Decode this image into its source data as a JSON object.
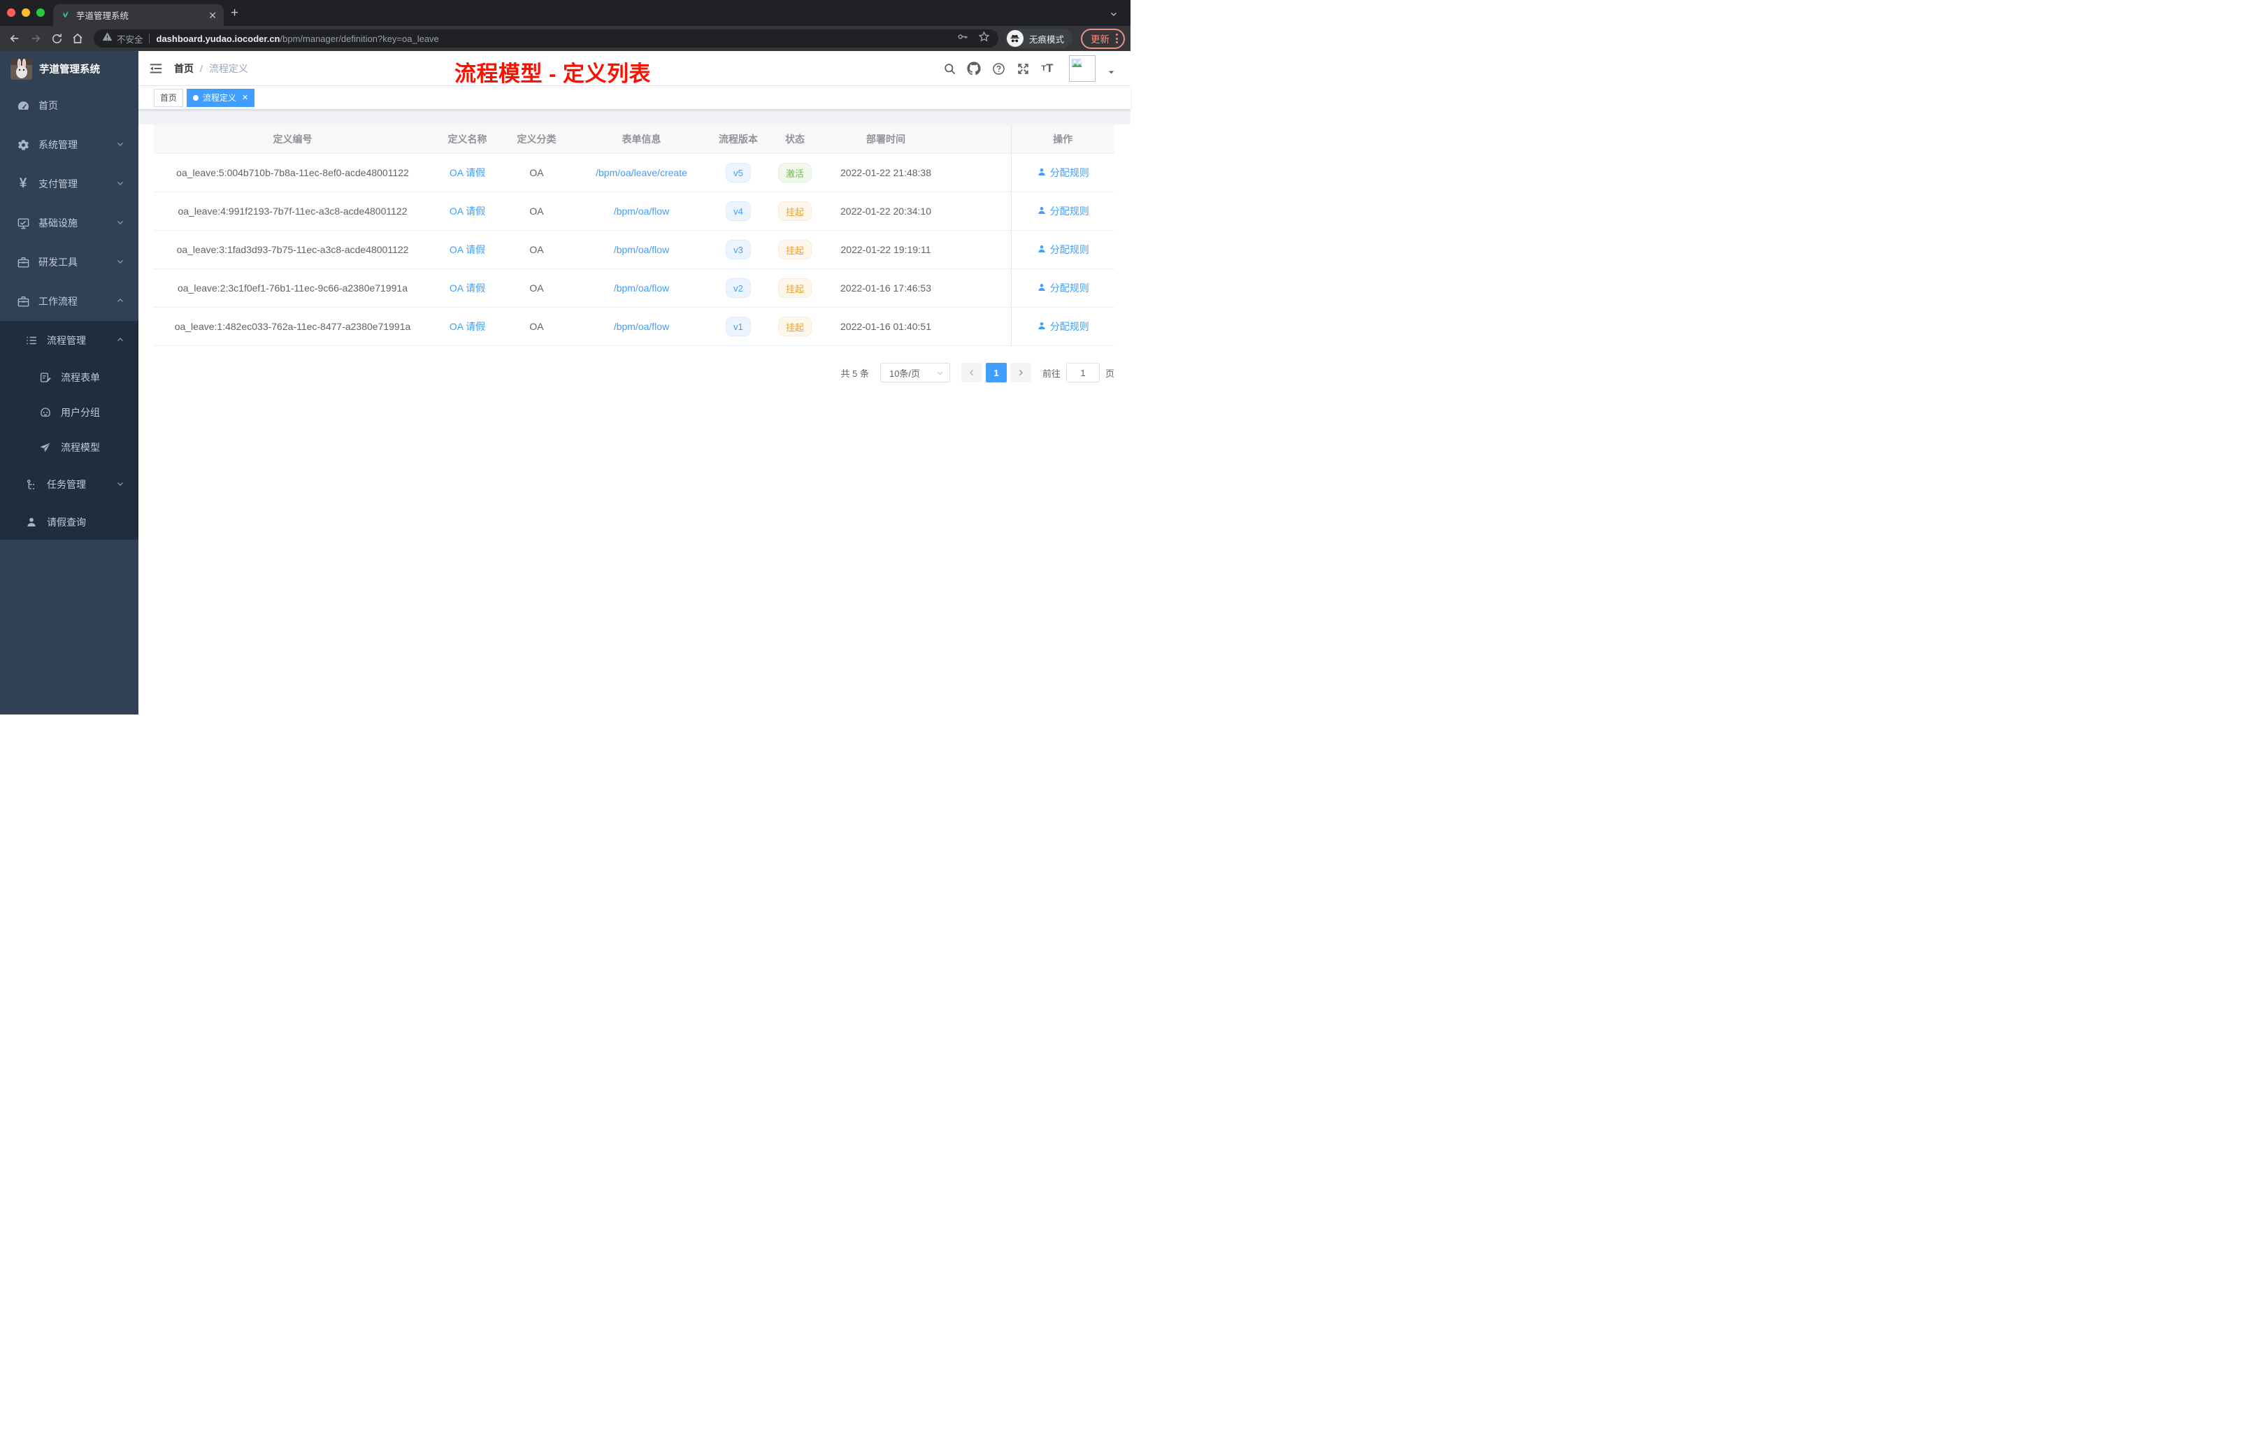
{
  "browser": {
    "tab_title": "芋道管理系统",
    "security_label": "不安全",
    "url_host": "dashboard.yudao.iocoder.cn",
    "url_path": "/bpm/manager/definition?key=oa_leave",
    "incognito_label": "无痕模式",
    "update_label": "更新"
  },
  "sidebar": {
    "app_title": "芋道管理系统",
    "items": [
      {
        "label": "首页"
      },
      {
        "label": "系统管理"
      },
      {
        "label": "支付管理"
      },
      {
        "label": "基础设施"
      },
      {
        "label": "研发工具"
      },
      {
        "label": "工作流程"
      },
      {
        "label": "流程管理"
      },
      {
        "label": "流程表单"
      },
      {
        "label": "用户分组"
      },
      {
        "label": "流程模型"
      },
      {
        "label": "任务管理"
      },
      {
        "label": "请假查询"
      }
    ]
  },
  "navbar": {
    "breadcrumb_home": "首页",
    "breadcrumb_separator": "/",
    "breadcrumb_current": "流程定义",
    "annotation": "流程模型 - 定义列表"
  },
  "tags": {
    "home": "首页",
    "active": "流程定义"
  },
  "table": {
    "columns": {
      "id": "定义编号",
      "name": "定义名称",
      "category": "定义分类",
      "form": "表单信息",
      "version": "流程版本",
      "status": "状态",
      "deploy_time": "部署时间",
      "actions": "操作"
    },
    "action_label": "分配规则",
    "rows": [
      {
        "id": "oa_leave:5:004b710b-7b8a-11ec-8ef0-acde48001122",
        "name": "OA 请假",
        "category": "OA",
        "form": "/bpm/oa/leave/create",
        "version": "v5",
        "status": "激活",
        "status_type": "success",
        "deploy_time": "2022-01-22 21:48:38"
      },
      {
        "id": "oa_leave:4:991f2193-7b7f-11ec-a3c8-acde48001122",
        "name": "OA 请假",
        "category": "OA",
        "form": "/bpm/oa/flow",
        "version": "v4",
        "status": "挂起",
        "status_type": "warning",
        "deploy_time": "2022-01-22 20:34:10"
      },
      {
        "id": "oa_leave:3:1fad3d93-7b75-11ec-a3c8-acde48001122",
        "name": "OA 请假",
        "category": "OA",
        "form": "/bpm/oa/flow",
        "version": "v3",
        "status": "挂起",
        "status_type": "warning",
        "deploy_time": "2022-01-22 19:19:11"
      },
      {
        "id": "oa_leave:2:3c1f0ef1-76b1-11ec-9c66-a2380e71991a",
        "name": "OA 请假",
        "category": "OA",
        "form": "/bpm/oa/flow",
        "version": "v2",
        "status": "挂起",
        "status_type": "warning",
        "deploy_time": "2022-01-16 17:46:53"
      },
      {
        "id": "oa_leave:1:482ec033-762a-11ec-8477-a2380e71991a",
        "name": "OA 请假",
        "category": "OA",
        "form": "/bpm/oa/flow",
        "version": "v1",
        "status": "挂起",
        "status_type": "warning",
        "deploy_time": "2022-01-16 01:40:51"
      }
    ]
  },
  "pagination": {
    "total": "共 5 条",
    "page_size": "10条/页",
    "current_page": "1",
    "goto_label": "前往",
    "goto_value": "1",
    "page_unit": "页"
  },
  "colors": {
    "accent": "#409eff",
    "success": "#67c23a",
    "warning": "#e6a23c",
    "sidebar_bg": "#304156",
    "submenu_bg": "#1f2d3d",
    "annotation": "#fe1000"
  }
}
